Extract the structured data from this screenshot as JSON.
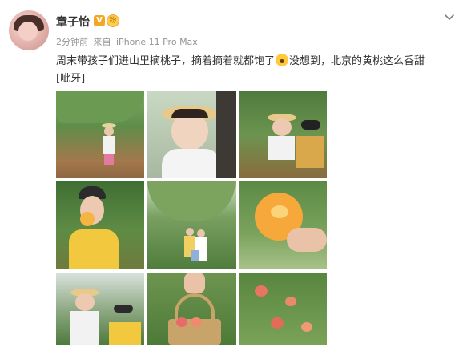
{
  "post": {
    "author": {
      "name": "章子怡",
      "verified_badge": "V",
      "fan_badge": "粉"
    },
    "meta": {
      "time": "2分钟前",
      "source_prefix": "来自",
      "device": "iPhone 11 Pro Max"
    },
    "text": {
      "part1": "周末带孩子们进山里摘桃子，摘着摘着就都饱了",
      "part2": "没想到，北京的黄桃这么香甜",
      "part3": "[呲牙]"
    },
    "photos": [
      {
        "name": "photo-child-picking-peach"
      },
      {
        "name": "photo-child-visor-hat"
      },
      {
        "name": "photo-children-orchard"
      },
      {
        "name": "photo-woman-eating-peach"
      },
      {
        "name": "photo-family-in-orchard"
      },
      {
        "name": "photo-hand-holding-peach"
      },
      {
        "name": "photo-child-and-woman"
      },
      {
        "name": "photo-basket-of-peaches"
      },
      {
        "name": "photo-peach-tree-branch"
      }
    ]
  },
  "colors": {
    "name_text": "#333333",
    "meta_text": "#939393",
    "verified_badge": "#f5a623",
    "background": "#ffffff"
  },
  "icons": {
    "more": "chevron-down-icon",
    "emoji_inline": "grin-emoji-icon"
  }
}
